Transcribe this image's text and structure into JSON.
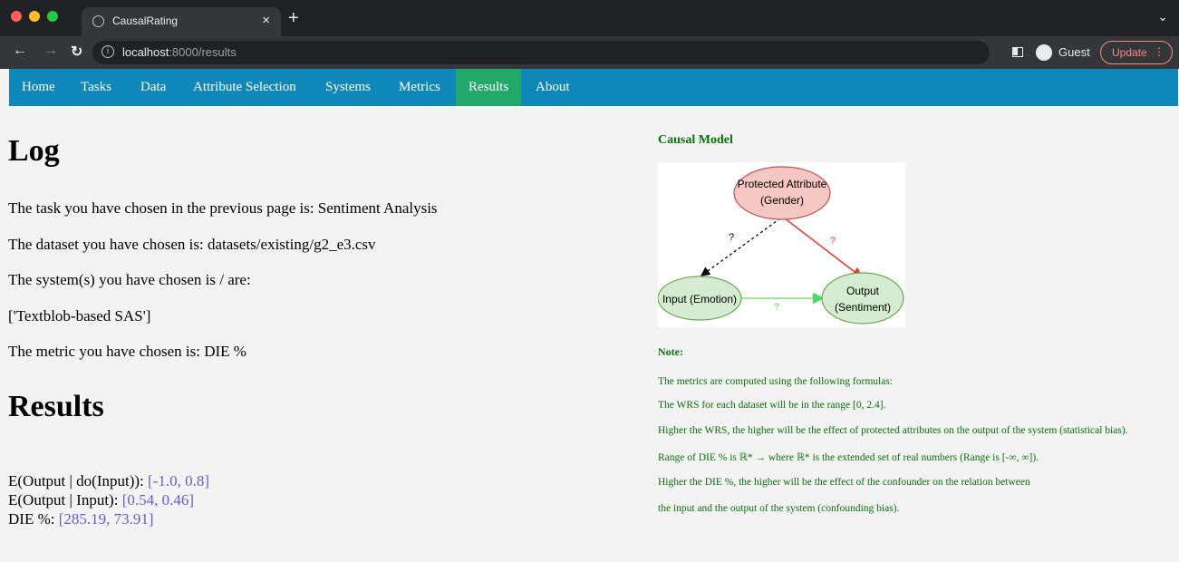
{
  "browser": {
    "tab_title": "CausalRating",
    "tab_close": "×",
    "new_tab": "+",
    "url_host": "localhost",
    "url_path": ":8000/results",
    "profile_label": "Guest",
    "update_label": "Update",
    "traffic_colors": [
      "#ff5f57",
      "#febc2e",
      "#28c840"
    ]
  },
  "nav": {
    "items": [
      "Home",
      "Tasks",
      "Data",
      "Attribute Selection",
      "Systems",
      "Metrics",
      "Results",
      "About"
    ],
    "active": "Results",
    "accent": "#0f87b8",
    "active_color": "#22a96a"
  },
  "log": {
    "heading": "Log",
    "task_line": "The task you have chosen in the previous page is: Sentiment Analysis",
    "dataset_line": "The dataset you have chosen is: datasets/existing/g2_e3.csv",
    "system_line": "The system(s) you have chosen is / are:",
    "systems_value": "['Textblob-based SAS']",
    "metric_line": "The metric you have chosen is: DIE %"
  },
  "results": {
    "heading": "Results",
    "rows": [
      {
        "label": "E(Output | do(Input)): ",
        "value": "[-1.0, 0.8]"
      },
      {
        "label": "E(Output | Input): ",
        "value": "[0.54, 0.46]"
      },
      {
        "label": "DIE %: ",
        "value": "[285.19, 73.91]"
      }
    ]
  },
  "causal_model": {
    "title": "Causal Model",
    "nodes": {
      "protected_line1": "Protected Attribute",
      "protected_line2": "(Gender)",
      "input": "Input (Emotion)",
      "output_line1": "Output",
      "output_line2": "(Sentiment)"
    },
    "edge_labels": {
      "protected_to_input": "?",
      "protected_to_output": "?",
      "input_to_output": "?"
    }
  },
  "note": {
    "title": "Note:",
    "lines": [
      "The metrics are computed using the following formulas:",
      "The WRS for each dataset will be in the range [0, 2.4].",
      "Higher the WRS, the higher will be the effect of protected attributes on the output of the system (statistical bias).",
      "Range of DIE % is ℝ* → where ℝ* is the extended set of real numbers (Range is [-∞, ∞]).",
      "Higher the DIE %, the higher will be the effect of the confounder on the relation between",
      "the input and the output of the system (confounding bias)."
    ]
  }
}
